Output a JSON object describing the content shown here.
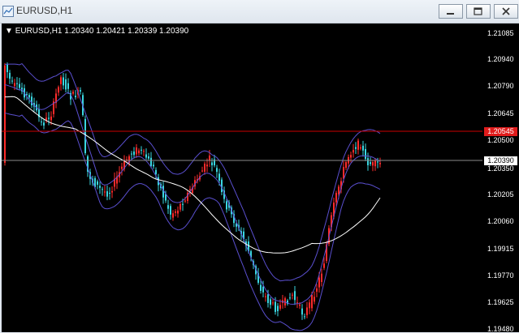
{
  "window": {
    "title": "EURUSD,H1",
    "buttons": [
      "minimize",
      "restore",
      "close"
    ]
  },
  "chart": {
    "symbol_label": "EURUSD,H1",
    "ohlc": "1.20340 1.20421 1.20339 1.20390",
    "ticks": [
      "1.21085",
      "1.20940",
      "1.20790",
      "1.20645",
      "1.20500",
      "1.20350",
      "1.20205",
      "1.20060",
      "1.19915",
      "1.19770",
      "1.19625",
      "1.19480"
    ],
    "current_price": "1.20390",
    "alert_level": "1.20545",
    "colors": {
      "background": "#000000",
      "bull": "#ff2b2b",
      "bear": "#3ad6e0",
      "bands": "#5a4fcf",
      "moving_average": "#ffffff",
      "alert_line": "#cc0000",
      "price_line": "#8a8a8a"
    }
  }
}
